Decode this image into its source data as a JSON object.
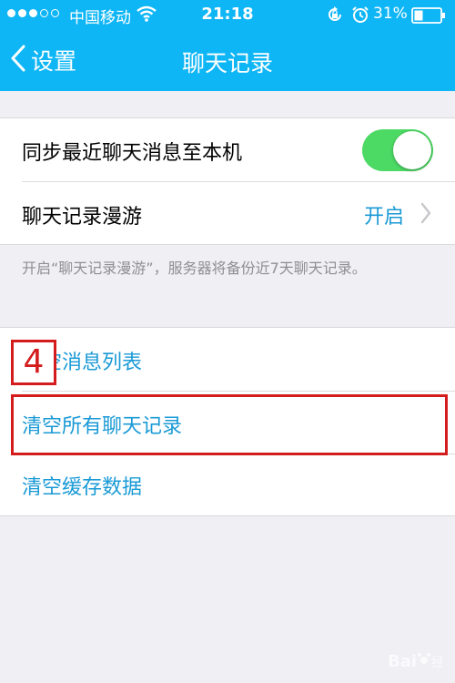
{
  "status_bar": {
    "carrier": "中国移动",
    "time": "21:18",
    "battery_percent": "31%",
    "signal_filled": 3,
    "signal_total": 5
  },
  "nav": {
    "back_label": "设置",
    "title": "聊天记录"
  },
  "settings": {
    "sync_label": "同步最近聊天消息至本机",
    "sync_enabled": true,
    "roaming_label": "聊天记录漫游",
    "roaming_value": "开启",
    "roaming_note": "开启“聊天记录漫游”，服务器将备份近7天聊天记录。"
  },
  "actions": {
    "clear_message_list": "清空消息列表",
    "clear_all_history": "清空所有聊天记录",
    "clear_cache": "清空缓存数据"
  },
  "annotation": {
    "step_number": "4"
  },
  "colors": {
    "accent": "#0fb6f6",
    "action_text": "#1a9ad6",
    "toggle_on": "#4cd964",
    "annotation_red": "#d41c1c"
  },
  "icons": [
    "wifi-icon",
    "rotation-lock-icon",
    "alarm-icon",
    "battery-icon",
    "back-chevron-icon",
    "chevron-right-icon",
    "baidu-paw-icon"
  ]
}
